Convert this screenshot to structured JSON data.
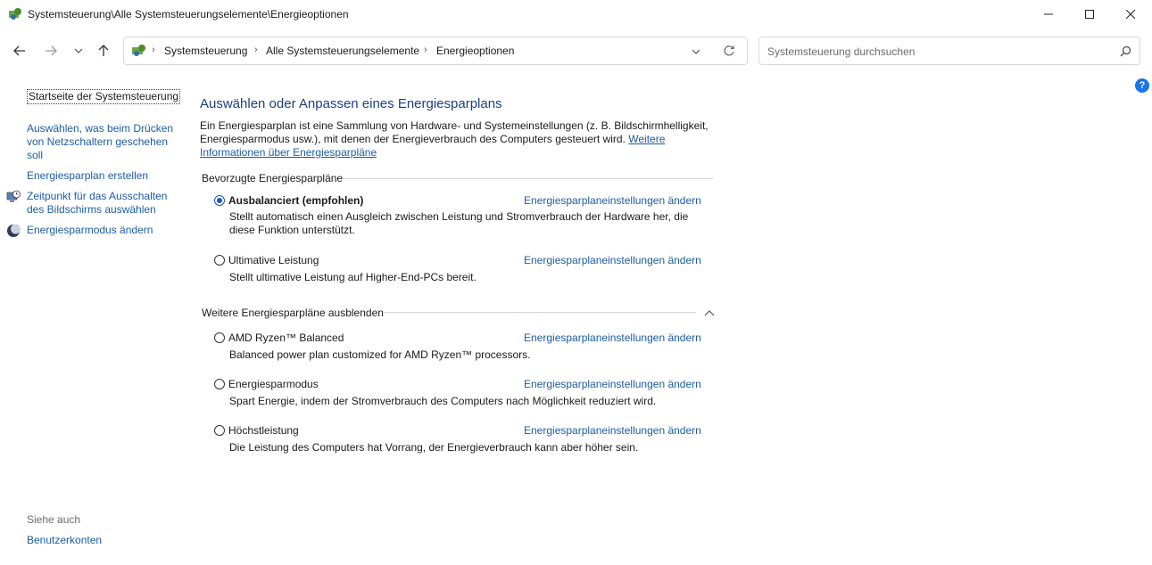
{
  "window": {
    "title": "Systemsteuerung\\Alle Systemsteuerungselemente\\Energieoptionen"
  },
  "address": {
    "crumbs": [
      "Systemsteuerung",
      "Alle Systemsteuerungselemente",
      "Energieoptionen"
    ]
  },
  "search": {
    "placeholder": "Systemsteuerung durchsuchen"
  },
  "sidebar": {
    "home": "Startseite der Systemsteuerung",
    "items": [
      {
        "label": "Auswählen, was beim Drücken von Netzschaltern geschehen soll",
        "icon": "none"
      },
      {
        "label": "Energiesparplan erstellen",
        "icon": "none"
      },
      {
        "label": "Zeitpunkt für das Ausschalten des Bildschirms auswählen",
        "icon": "monitor-clock-icon"
      },
      {
        "label": "Energiesparmodus ändern",
        "icon": "moon-icon"
      }
    ],
    "see_also": "Siehe auch",
    "see_also_items": [
      "Benutzerkonten"
    ]
  },
  "main": {
    "heading": "Auswählen oder Anpassen eines Energiesparplans",
    "description": "Ein Energiesparplan ist eine Sammlung von Hardware- und Systemeinstellungen (z. B. Bildschirmhelligkeit, Energiesparmodus usw.), mit denen der Energieverbrauch des Computers gesteuert wird.",
    "more_info_link": "Weitere Informationen über Energiesparpläne",
    "preferred_section": "Bevorzugte Energiesparpläne",
    "hide_section": "Weitere Energiesparpläne ausblenden",
    "change_link": "Energiesparplaneinstellungen ändern",
    "preferred_plans": [
      {
        "name": "Ausbalanciert (empfohlen)",
        "selected": true,
        "description": "Stellt automatisch einen Ausgleich zwischen Leistung und Stromverbrauch der Hardware her, die diese Funktion unterstützt."
      },
      {
        "name": "Ultimative Leistung",
        "selected": false,
        "description": "Stellt ultimative Leistung auf Higher-End-PCs bereit."
      }
    ],
    "additional_plans": [
      {
        "name": "AMD Ryzen™ Balanced",
        "selected": false,
        "description": "Balanced power plan customized for AMD Ryzen™ processors."
      },
      {
        "name": "Energiesparmodus",
        "selected": false,
        "description": "Spart Energie, indem der Stromverbrauch des Computers nach Möglichkeit reduziert wird."
      },
      {
        "name": "Höchstleistung",
        "selected": false,
        "description": "Die Leistung des Computers hat Vorrang, der Energieverbrauch kann aber höher sein."
      }
    ]
  },
  "help": "?",
  "colors": {
    "link": "#1c5ca8",
    "heading": "#1c3f87",
    "radio_selected": "#1a56b8"
  }
}
